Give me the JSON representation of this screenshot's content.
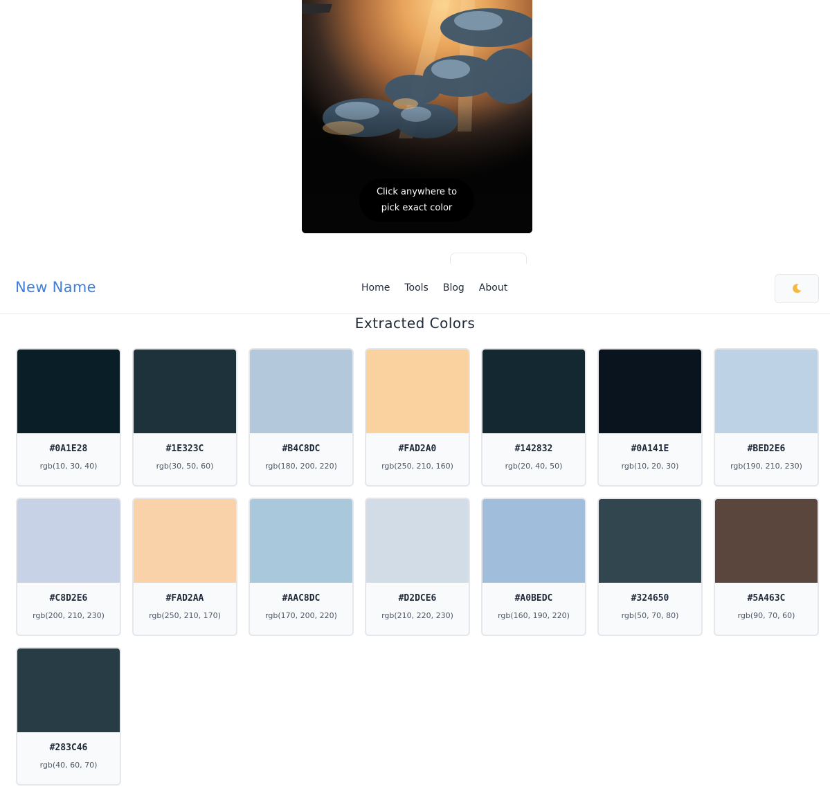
{
  "image_panel": {
    "hint_line1": "Click anywhere to",
    "hint_line2": "pick exact color"
  },
  "navbar": {
    "brand": "New Name",
    "links": [
      "Home",
      "Tools",
      "Blog",
      "About"
    ],
    "theme_toggle_icon": "moon-icon"
  },
  "section": {
    "title": "Extracted Colors"
  },
  "colors": [
    {
      "hex": "#0A1E28",
      "rgb": "rgb(10, 30, 40)"
    },
    {
      "hex": "#1E323C",
      "rgb": "rgb(30, 50, 60)"
    },
    {
      "hex": "#B4C8DC",
      "rgb": "rgb(180, 200, 220)"
    },
    {
      "hex": "#FAD2A0",
      "rgb": "rgb(250, 210, 160)"
    },
    {
      "hex": "#142832",
      "rgb": "rgb(20, 40, 50)"
    },
    {
      "hex": "#0A141E",
      "rgb": "rgb(10, 20, 30)"
    },
    {
      "hex": "#BED2E6",
      "rgb": "rgb(190, 210, 230)"
    },
    {
      "hex": "#C8D2E6",
      "rgb": "rgb(200, 210, 230)"
    },
    {
      "hex": "#FAD2AA",
      "rgb": "rgb(250, 210, 170)"
    },
    {
      "hex": "#AAC8DC",
      "rgb": "rgb(170, 200, 220)"
    },
    {
      "hex": "#D2DCE6",
      "rgb": "rgb(210, 220, 230)"
    },
    {
      "hex": "#A0BEDC",
      "rgb": "rgb(160, 190, 220)"
    },
    {
      "hex": "#324650",
      "rgb": "rgb(50, 70, 80)"
    },
    {
      "hex": "#5A463C",
      "rgb": "rgb(90, 70, 60)"
    },
    {
      "hex": "#283C46",
      "rgb": "rgb(40, 60, 70)"
    }
  ]
}
